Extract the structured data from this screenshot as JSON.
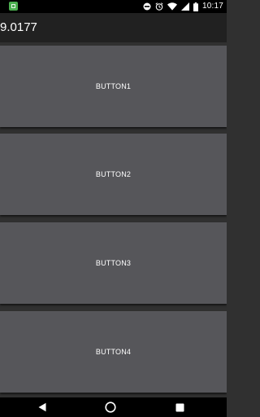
{
  "status_bar": {
    "time": "10:17",
    "icons": [
      "notification-app-icon",
      "do-not-disturb-icon",
      "alarm-icon",
      "wifi-icon",
      "signal-icon",
      "battery-icon"
    ]
  },
  "toolbar": {
    "title": "9.0177"
  },
  "buttons": [
    {
      "label": "BUTTON1"
    },
    {
      "label": "BUTTON2"
    },
    {
      "label": "BUTTON3"
    },
    {
      "label": "BUTTON4"
    }
  ],
  "nav_bar": {
    "icons": [
      "back-icon",
      "home-icon",
      "recents-icon"
    ]
  },
  "colors": {
    "status_bar": "#000000",
    "toolbar": "#212121",
    "background": "#303030",
    "button": "#56565a",
    "text": "#ffffff",
    "notification_icon": "#4caf50"
  }
}
